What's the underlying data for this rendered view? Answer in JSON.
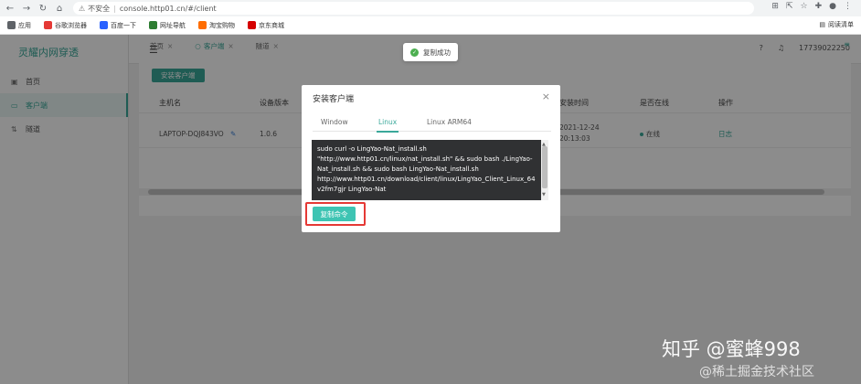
{
  "browser": {
    "url_warning": "不安全",
    "url": "console.http01.cn/#/client",
    "bookmarks": [
      {
        "label": "应用",
        "icon": "apps-icon",
        "color": "#5f6368"
      },
      {
        "label": "谷歌浏览器",
        "icon": "chrome-icon",
        "color": "#e53935"
      },
      {
        "label": "百度一下",
        "icon": "baidu-icon",
        "color": "#2962ff"
      },
      {
        "label": "网址导航",
        "icon": "nav-icon",
        "color": "#2e7d32"
      },
      {
        "label": "淘宝购物",
        "icon": "taobao-icon",
        "color": "#ff6d00"
      },
      {
        "label": "京东商城",
        "icon": "jd-icon",
        "color": "#d50000"
      }
    ],
    "reading_list": "阅读清单"
  },
  "sidebar": {
    "brand": "灵耀内网穿透",
    "items": [
      {
        "label": "首页",
        "icon": "home-icon",
        "active": false
      },
      {
        "label": "客户端",
        "icon": "monitor-icon",
        "active": true
      },
      {
        "label": "隧道",
        "icon": "tunnel-icon",
        "active": false
      }
    ]
  },
  "header": {
    "phone": "17739022250"
  },
  "tabs": [
    {
      "label": "首页",
      "active": false
    },
    {
      "label": "客户端",
      "active": true
    },
    {
      "label": "隧道",
      "active": false
    }
  ],
  "content": {
    "install_button": "安装客户端",
    "columns": [
      "主机名",
      "设备版本",
      "安装时间",
      "是否在线",
      "操作"
    ],
    "rows": [
      {
        "host": "LAPTOP-DQJ843VO",
        "version": "1.0.6",
        "install_date": "2021-12-24",
        "install_time": "20:13:03",
        "status": "在线",
        "action": "日志"
      }
    ]
  },
  "toast": {
    "message": "复制成功"
  },
  "modal": {
    "title": "安装客户端",
    "tabs": [
      "Window",
      "Linux",
      "Linux ARM64"
    ],
    "active_tab": "Linux",
    "command_lines": [
      "sudo curl -o LingYao-Nat_install.sh",
      "\"http://www.http01.cn/linux/nat_install.sh\" && sudo bash ./LingYao-",
      "Nat_install.sh && sudo bash LingYao-Nat_install.sh",
      "http://www.http01.cn/download/client/linux/LingYao_Client_Linux_64",
      "v2fm7gjr LingYao-Nat"
    ],
    "copy_button": "复制命令"
  },
  "watermark": {
    "line1": "知乎 @蜜蜂998",
    "line2": "@稀土掘金技术社区"
  },
  "colors": {
    "accent": "#3aa89a",
    "highlight": "#e53935"
  }
}
